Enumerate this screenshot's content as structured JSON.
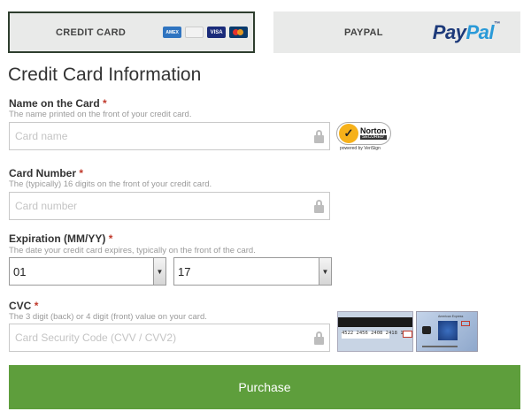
{
  "tabs": {
    "credit_card": {
      "label": "CREDIT CARD",
      "logos": [
        "AMEX",
        "DISCOVER",
        "VISA",
        "MASTERCARD"
      ]
    },
    "paypal": {
      "label": "PAYPAL",
      "logo_a": "Pay",
      "logo_b": "Pal",
      "logo_tm": "™"
    }
  },
  "page_title": "Credit Card Information",
  "name_field": {
    "label": "Name on the Card",
    "required_mark": "*",
    "help": "The name printed on the front of your credit card.",
    "placeholder": "Card name",
    "value": ""
  },
  "norton": {
    "check": "✓",
    "name": "Norton",
    "secured": "SECURED",
    "powered": "powered by VeriSign"
  },
  "number_field": {
    "label": "Card Number",
    "required_mark": "*",
    "help": "The (typically) 16 digits on the front of your credit card.",
    "placeholder": "Card number",
    "value": ""
  },
  "expiration": {
    "label": "Expiration (MM/YY)",
    "required_mark": "*",
    "help": "The date your credit card expires, typically on the front of the card.",
    "month_value": "01",
    "year_value": "17"
  },
  "cvc_field": {
    "label": "CVC",
    "required_mark": "*",
    "help": "The 3 digit (back) or 4 digit (front) value on your card.",
    "placeholder": "Card Security Code (CVV / CVV2)",
    "value": "",
    "back_card_number": "4522 2456 2408 2418 123",
    "front_card_bank": "American Express"
  },
  "purchase_button": {
    "label": "Purchase"
  },
  "colors": {
    "accent_green": "#5e9e3c",
    "required_red": "#c0392b",
    "tab_bg": "#e9eae9"
  }
}
